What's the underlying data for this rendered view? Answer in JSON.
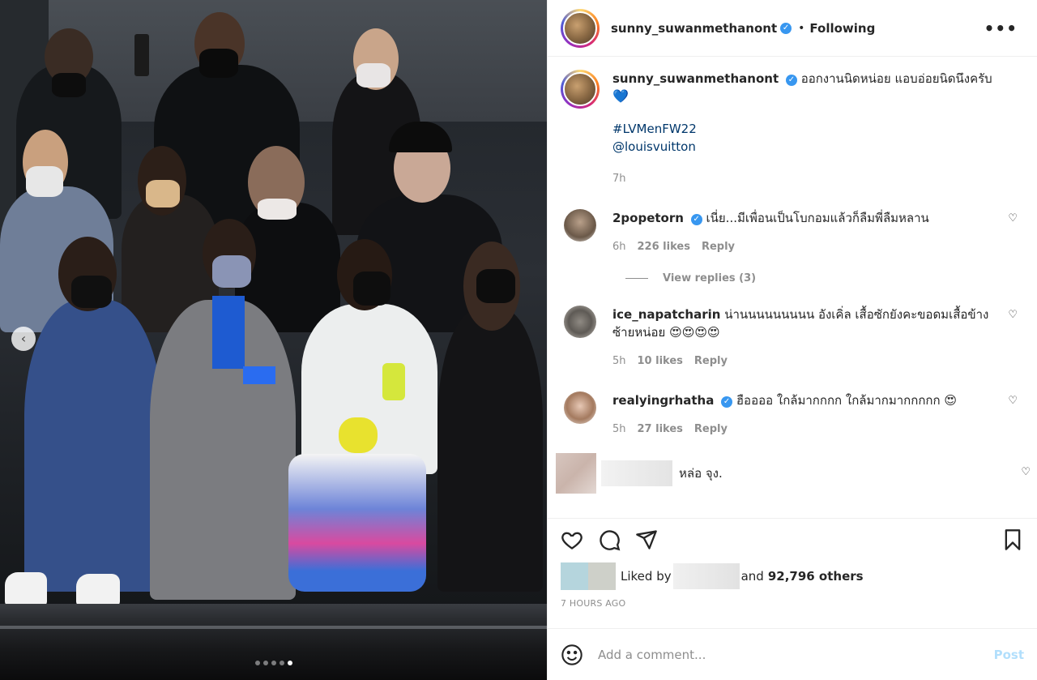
{
  "post": {
    "username": "sunny_suwanmethanont",
    "verified_icon": "verified-badge-icon",
    "following_label": "Following",
    "separator": "•",
    "more_label": "•••"
  },
  "caption": {
    "username": "sunny_suwanmethanont",
    "text": "ออกงานนิดหน่อย แอบอ่อยนิดนึงครับ",
    "heart": "💙",
    "hashtag": "#LVMenFW22",
    "mention": "@louisvuitton",
    "age": "7h"
  },
  "comments": [
    {
      "username": "2popetorn",
      "verified": true,
      "text": "เนี่ย...มีเพื่อนเป็นโบกอมแล้วก็ลืมพี่ลืมหลาน",
      "age": "6h",
      "likes": "226 likes",
      "reply": "Reply",
      "view_replies": "View replies (3)"
    },
    {
      "username": "ice_napatcharin",
      "verified": false,
      "text": "น่านนนนนนนนน อังเคิ่ล เสื้อซักยังคะขอดมเสื้อข้างซ้ายหน่อย 😍😍😍😍",
      "age": "5h",
      "likes": "10 likes",
      "reply": "Reply"
    },
    {
      "username": "realyingrhatha",
      "verified": true,
      "text": "ฮืออออ ใกล้มากกกก ใกล้มากมากกกกก 😍",
      "age": "5h",
      "likes": "27 likes",
      "reply": "Reply"
    },
    {
      "text": "หล่อ จุง."
    }
  ],
  "actions": {
    "liked_by": "Liked by",
    "and_others": "and",
    "others_count": "92,796 others",
    "time": "7 HOURS AGO",
    "add_placeholder": "Add a comment...",
    "post_label": "Post"
  },
  "carousel": {
    "prev_arrow": "‹",
    "slide_count": 5,
    "active_slide": 5
  },
  "colors": {
    "link": "#00376b",
    "verified": "#3897f0",
    "post_disabled": "#b2dffc",
    "muted": "#8e8e8e"
  }
}
